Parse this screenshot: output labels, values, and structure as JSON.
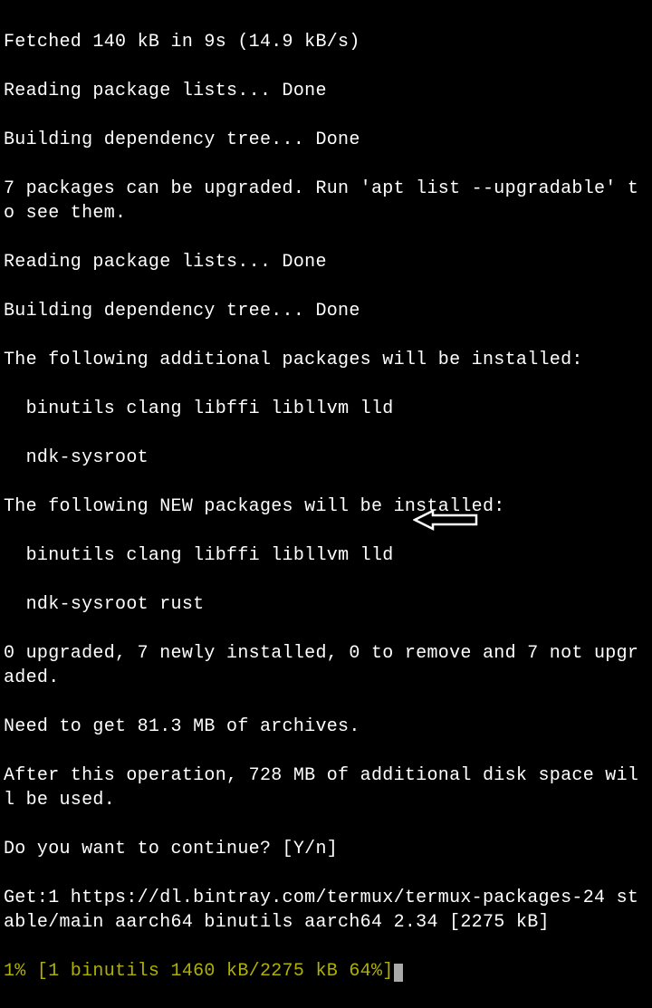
{
  "terminal": {
    "lines": [
      "Fetched 140 kB in 9s (14.9 kB/s)",
      "Reading package lists... Done",
      "Building dependency tree... Done",
      "7 packages can be upgraded. Run 'apt list --upgradable' to see them.",
      "Reading package lists... Done",
      "Building dependency tree... Done",
      "The following additional packages will be installed:",
      "  binutils clang libffi libllvm lld",
      "  ndk-sysroot",
      "The following NEW packages will be installed:",
      "  binutils clang libffi libllvm lld",
      "  ndk-sysroot rust",
      "0 upgraded, 7 newly installed, 0 to remove and 7 not upgraded.",
      "Need to get 81.3 MB of archives.",
      "After this operation, 728 MB of additional disk space will be used.",
      "Do you want to continue? [Y/n]",
      "Get:1 https://dl.bintray.com/termux/termux-packages-24 stable/main aarch64 binutils aarch64 2.34 [2275 kB]"
    ],
    "progress": "1% [1 binutils 1460 kB/2275 kB 64%]"
  },
  "annotation": {
    "arrow_points_to": "continue-prompt"
  }
}
